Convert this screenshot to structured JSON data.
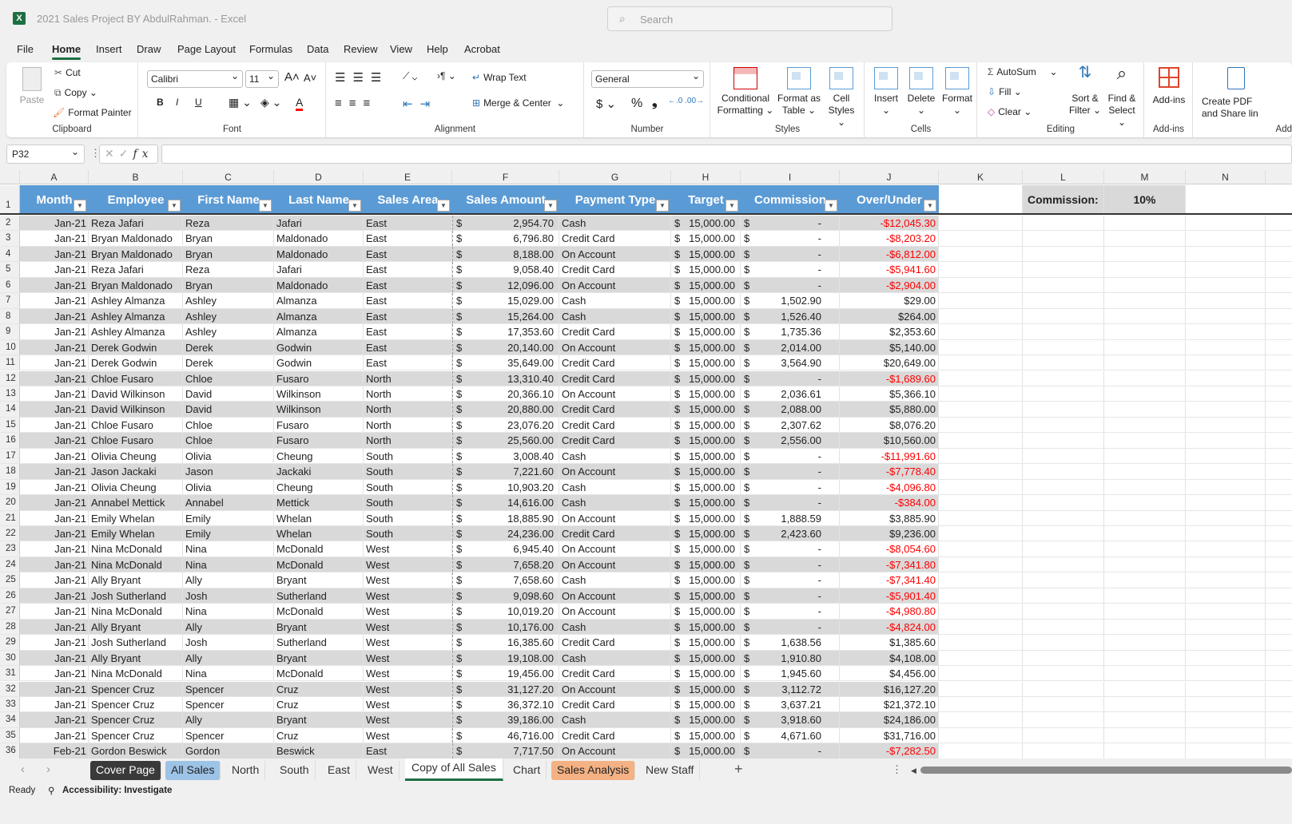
{
  "window": {
    "title": "2021 Sales Project BY AbdulRahman.  -  Excel",
    "app_icon": "excel-icon",
    "search_placeholder": "Search"
  },
  "menu": [
    "File",
    "Home",
    "Insert",
    "Draw",
    "Page Layout",
    "Formulas",
    "Data",
    "Review",
    "View",
    "Help",
    "Acrobat"
  ],
  "menu_active": "Home",
  "ribbon": {
    "clipboard": {
      "label": "Clipboard",
      "paste": "Paste",
      "cut": "Cut",
      "copy": "Copy",
      "format_painter": "Format Painter"
    },
    "font": {
      "label": "Font",
      "name": "Calibri",
      "size": "11",
      "bold": "B",
      "italic": "I",
      "underline": "U",
      "font_color": "#ff0000"
    },
    "alignment": {
      "label": "Alignment",
      "wrap_text": "Wrap Text",
      "merge_center": "Merge & Center"
    },
    "number": {
      "label": "Number",
      "format": "General",
      "currency": "$",
      "percent": "%",
      "comma": "❟"
    },
    "styles": {
      "label": "Styles",
      "conditional": [
        "Conditional",
        "Formatting ⌄"
      ],
      "format_table": [
        "Format as",
        "Table ⌄"
      ],
      "cell_styles": [
        "Cell",
        "Styles ⌄"
      ]
    },
    "cells": {
      "label": "Cells",
      "insert": "Insert",
      "delete": "Delete",
      "format": "Format"
    },
    "editing": {
      "label": "Editing",
      "autosum": "AutoSum",
      "fill": "Fill ⌄",
      "clear": "Clear ⌄",
      "sort": [
        "Sort &",
        "Filter ⌄"
      ],
      "find": [
        "Find &",
        "Select ⌄"
      ]
    },
    "addins": {
      "label": "Add-ins",
      "addins": "Add-ins"
    },
    "acrobat": {
      "label": "Add",
      "create": [
        "Create PDF",
        "and Share lin"
      ]
    }
  },
  "formula_bar": {
    "name_box": "P32",
    "formula": ""
  },
  "columns": [
    "A",
    "B",
    "C",
    "D",
    "E",
    "F",
    "G",
    "H",
    "I",
    "J",
    "K",
    "L",
    "M",
    "N"
  ],
  "table": {
    "headers": [
      "Month",
      "Employee",
      "First Name",
      "Last Name",
      "Sales Area",
      "Sales Amount",
      "Payment Type",
      "Target",
      "Commission",
      "Over/Under"
    ],
    "side_label": "Commission:",
    "side_value": "10%",
    "header_color": "#5b9bd5",
    "band_color": "#d9d9d9",
    "negative_color": "#ff0000",
    "rows": [
      [
        "Jan-21",
        "Reza Jafari",
        "Reza",
        "Jafari",
        "East",
        "2,954.70",
        "Cash",
        "15,000.00",
        "-",
        "-$12,045.30"
      ],
      [
        "Jan-21",
        "Bryan Maldonado",
        "Bryan",
        "Maldonado",
        "East",
        "6,796.80",
        "Credit Card",
        "15,000.00",
        "-",
        "-$8,203.20"
      ],
      [
        "Jan-21",
        "Bryan Maldonado",
        "Bryan",
        "Maldonado",
        "East",
        "8,188.00",
        "On Account",
        "15,000.00",
        "-",
        "-$6,812.00"
      ],
      [
        "Jan-21",
        "Reza Jafari",
        "Reza",
        "Jafari",
        "East",
        "9,058.40",
        "Credit Card",
        "15,000.00",
        "-",
        "-$5,941.60"
      ],
      [
        "Jan-21",
        "Bryan Maldonado",
        "Bryan",
        "Maldonado",
        "East",
        "12,096.00",
        "On Account",
        "15,000.00",
        "-",
        "-$2,904.00"
      ],
      [
        "Jan-21",
        "Ashley Almanza",
        "Ashley",
        "Almanza",
        "East",
        "15,029.00",
        "Cash",
        "15,000.00",
        "1,502.90",
        "$29.00"
      ],
      [
        "Jan-21",
        "Ashley Almanza",
        "Ashley",
        "Almanza",
        "East",
        "15,264.00",
        "Cash",
        "15,000.00",
        "1,526.40",
        "$264.00"
      ],
      [
        "Jan-21",
        "Ashley Almanza",
        "Ashley",
        "Almanza",
        "East",
        "17,353.60",
        "Credit Card",
        "15,000.00",
        "1,735.36",
        "$2,353.60"
      ],
      [
        "Jan-21",
        "Derek Godwin",
        "Derek",
        "Godwin",
        "East",
        "20,140.00",
        "On Account",
        "15,000.00",
        "2,014.00",
        "$5,140.00"
      ],
      [
        "Jan-21",
        "Derek Godwin",
        "Derek",
        "Godwin",
        "East",
        "35,649.00",
        "Credit Card",
        "15,000.00",
        "3,564.90",
        "$20,649.00"
      ],
      [
        "Jan-21",
        "Chloe Fusaro",
        "Chloe",
        "Fusaro",
        "North",
        "13,310.40",
        "Credit Card",
        "15,000.00",
        "-",
        "-$1,689.60"
      ],
      [
        "Jan-21",
        "David Wilkinson",
        "David",
        "Wilkinson",
        "North",
        "20,366.10",
        "On Account",
        "15,000.00",
        "2,036.61",
        "$5,366.10"
      ],
      [
        "Jan-21",
        "David Wilkinson",
        "David",
        "Wilkinson",
        "North",
        "20,880.00",
        "Credit Card",
        "15,000.00",
        "2,088.00",
        "$5,880.00"
      ],
      [
        "Jan-21",
        "Chloe Fusaro",
        "Chloe",
        "Fusaro",
        "North",
        "23,076.20",
        "Credit Card",
        "15,000.00",
        "2,307.62",
        "$8,076.20"
      ],
      [
        "Jan-21",
        "Chloe Fusaro",
        "Chloe",
        "Fusaro",
        "North",
        "25,560.00",
        "Credit Card",
        "15,000.00",
        "2,556.00",
        "$10,560.00"
      ],
      [
        "Jan-21",
        "Olivia Cheung",
        "Olivia",
        "Cheung",
        "South",
        "3,008.40",
        "Cash",
        "15,000.00",
        "-",
        "-$11,991.60"
      ],
      [
        "Jan-21",
        "Jason Jackaki",
        "Jason",
        "Jackaki",
        "South",
        "7,221.60",
        "On Account",
        "15,000.00",
        "-",
        "-$7,778.40"
      ],
      [
        "Jan-21",
        "Olivia Cheung",
        "Olivia",
        "Cheung",
        "South",
        "10,903.20",
        "Cash",
        "15,000.00",
        "-",
        "-$4,096.80"
      ],
      [
        "Jan-21",
        "Annabel Mettick",
        "Annabel",
        "Mettick",
        "South",
        "14,616.00",
        "Cash",
        "15,000.00",
        "-",
        "-$384.00"
      ],
      [
        "Jan-21",
        "Emily Whelan",
        "Emily",
        "Whelan",
        "South",
        "18,885.90",
        "On Account",
        "15,000.00",
        "1,888.59",
        "$3,885.90"
      ],
      [
        "Jan-21",
        "Emily Whelan",
        "Emily",
        "Whelan",
        "South",
        "24,236.00",
        "Credit Card",
        "15,000.00",
        "2,423.60",
        "$9,236.00"
      ],
      [
        "Jan-21",
        "Nina McDonald",
        "Nina",
        "McDonald",
        "West",
        "6,945.40",
        "On Account",
        "15,000.00",
        "-",
        "-$8,054.60"
      ],
      [
        "Jan-21",
        "Nina McDonald",
        "Nina",
        "McDonald",
        "West",
        "7,658.20",
        "On Account",
        "15,000.00",
        "-",
        "-$7,341.80"
      ],
      [
        "Jan-21",
        "Ally Bryant",
        "Ally",
        "Bryant",
        "West",
        "7,658.60",
        "Cash",
        "15,000.00",
        "-",
        "-$7,341.40"
      ],
      [
        "Jan-21",
        "Josh Sutherland",
        "Josh",
        "Sutherland",
        "West",
        "9,098.60",
        "On Account",
        "15,000.00",
        "-",
        "-$5,901.40"
      ],
      [
        "Jan-21",
        "Nina McDonald",
        "Nina",
        "McDonald",
        "West",
        "10,019.20",
        "On Account",
        "15,000.00",
        "-",
        "-$4,980.80"
      ],
      [
        "Jan-21",
        "Ally Bryant",
        "Ally",
        "Bryant",
        "West",
        "10,176.00",
        "Cash",
        "15,000.00",
        "-",
        "-$4,824.00"
      ],
      [
        "Jan-21",
        "Josh Sutherland",
        "Josh",
        "Sutherland",
        "West",
        "16,385.60",
        "Credit Card",
        "15,000.00",
        "1,638.56",
        "$1,385.60"
      ],
      [
        "Jan-21",
        "Ally Bryant",
        "Ally",
        "Bryant",
        "West",
        "19,108.00",
        "Cash",
        "15,000.00",
        "1,910.80",
        "$4,108.00"
      ],
      [
        "Jan-21",
        "Nina McDonald",
        "Nina",
        "McDonald",
        "West",
        "19,456.00",
        "Credit Card",
        "15,000.00",
        "1,945.60",
        "$4,456.00"
      ],
      [
        "Jan-21",
        "Spencer Cruz",
        "Spencer",
        "Cruz",
        "West",
        "31,127.20",
        "On Account",
        "15,000.00",
        "3,112.72",
        "$16,127.20"
      ],
      [
        "Jan-21",
        "Spencer Cruz",
        "Spencer",
        "Cruz",
        "West",
        "36,372.10",
        "Credit Card",
        "15,000.00",
        "3,637.21",
        "$21,372.10"
      ],
      [
        "Jan-21",
        "Spencer Cruz",
        "Ally",
        "Bryant",
        "West",
        "39,186.00",
        "Cash",
        "15,000.00",
        "3,918.60",
        "$24,186.00"
      ],
      [
        "Jan-21",
        "Spencer Cruz",
        "Spencer",
        "Cruz",
        "West",
        "46,716.00",
        "Credit Card",
        "15,000.00",
        "4,671.60",
        "$31,716.00"
      ],
      [
        "Feb-21",
        "Gordon Beswick",
        "Gordon",
        "Beswick",
        "East",
        "7,717.50",
        "On Account",
        "15,000.00",
        "-",
        "-$7,282.50"
      ]
    ]
  },
  "sheet_tabs": [
    {
      "label": "Cover Page",
      "bg": "#3a3a3a",
      "fg": "#ffffff"
    },
    {
      "label": "All Sales",
      "bg": "#9dc3e6",
      "fg": "#222222"
    },
    {
      "label": "North"
    },
    {
      "label": "South"
    },
    {
      "label": "East"
    },
    {
      "label": "West"
    },
    {
      "label": "Copy of All Sales",
      "active": true
    },
    {
      "label": "Chart"
    },
    {
      "label": "Sales Analysis",
      "bg": "#f4b183",
      "fg": "#222222"
    },
    {
      "label": "New Staff"
    }
  ],
  "status": {
    "ready": "Ready",
    "accessibility": "Accessibility: Investigate"
  }
}
